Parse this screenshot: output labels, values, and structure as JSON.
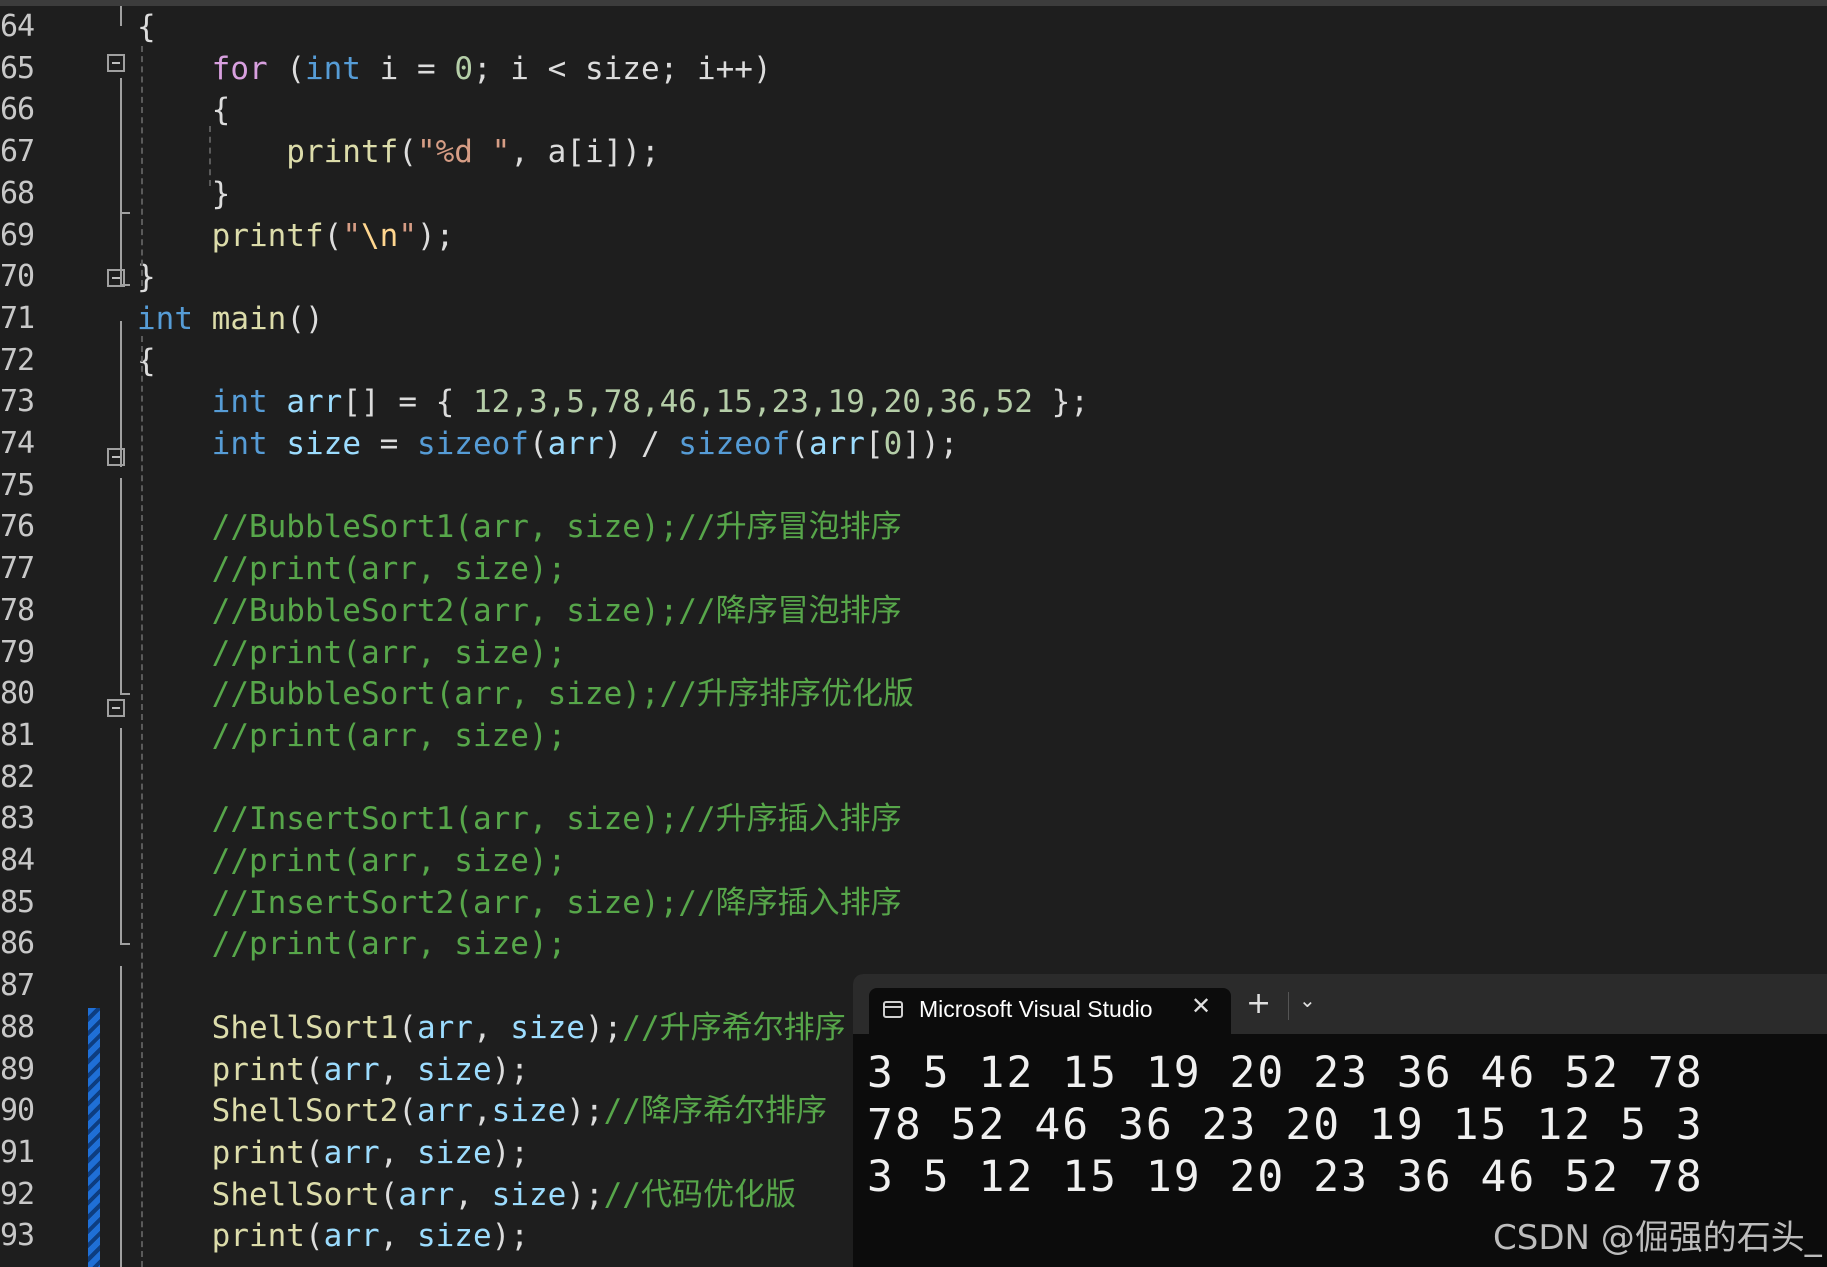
{
  "editor": {
    "lines": [
      {
        "n": "64",
        "segments": [
          {
            "c": "pun",
            "t": "{"
          }
        ]
      },
      {
        "n": "65",
        "segments": [
          {
            "c": "ctl",
            "t": "    for"
          },
          {
            "c": "pun",
            "t": " ("
          },
          {
            "c": "kw",
            "t": "int"
          },
          {
            "c": "pun",
            "t": " i = "
          },
          {
            "c": "num",
            "t": "0"
          },
          {
            "c": "pun",
            "t": "; i < size; i++)"
          }
        ]
      },
      {
        "n": "66",
        "segments": [
          {
            "c": "pun",
            "t": "    {"
          }
        ]
      },
      {
        "n": "67",
        "segments": [
          {
            "c": "fn",
            "t": "        printf"
          },
          {
            "c": "pun",
            "t": "("
          },
          {
            "c": "str",
            "t": "\"%d \""
          },
          {
            "c": "pun",
            "t": ", a[i]);"
          }
        ]
      },
      {
        "n": "68",
        "segments": [
          {
            "c": "pun",
            "t": "    }"
          }
        ]
      },
      {
        "n": "69",
        "segments": [
          {
            "c": "fn",
            "t": "    printf"
          },
          {
            "c": "pun",
            "t": "("
          },
          {
            "c": "str",
            "t": "\""
          },
          {
            "c": "esc",
            "t": "\\n"
          },
          {
            "c": "str",
            "t": "\""
          },
          {
            "c": "pun",
            "t": ");"
          }
        ]
      },
      {
        "n": "70",
        "segments": [
          {
            "c": "pun",
            "t": "}"
          }
        ]
      },
      {
        "n": "71",
        "segments": [
          {
            "c": "kw",
            "t": "int"
          },
          {
            "c": "pun",
            "t": " "
          },
          {
            "c": "fn",
            "t": "main"
          },
          {
            "c": "pun",
            "t": "()"
          }
        ]
      },
      {
        "n": "72",
        "segments": [
          {
            "c": "pun",
            "t": "{"
          }
        ]
      },
      {
        "n": "73",
        "segments": [
          {
            "c": "kw",
            "t": "    int"
          },
          {
            "c": "pun",
            "t": " "
          },
          {
            "c": "var",
            "t": "arr"
          },
          {
            "c": "pun",
            "t": "[] = { "
          },
          {
            "c": "num",
            "t": "12,3,5,78,46,15,23,19,20,36,52"
          },
          {
            "c": "pun",
            "t": " };"
          }
        ]
      },
      {
        "n": "74",
        "segments": [
          {
            "c": "kw",
            "t": "    int"
          },
          {
            "c": "pun",
            "t": " "
          },
          {
            "c": "var",
            "t": "size"
          },
          {
            "c": "pun",
            "t": " = "
          },
          {
            "c": "kw",
            "t": "sizeof"
          },
          {
            "c": "pun",
            "t": "("
          },
          {
            "c": "var",
            "t": "arr"
          },
          {
            "c": "pun",
            "t": ") / "
          },
          {
            "c": "kw",
            "t": "sizeof"
          },
          {
            "c": "pun",
            "t": "("
          },
          {
            "c": "var",
            "t": "arr"
          },
          {
            "c": "pun",
            "t": "["
          },
          {
            "c": "num",
            "t": "0"
          },
          {
            "c": "pun",
            "t": "]);"
          }
        ]
      },
      {
        "n": "75",
        "segments": []
      },
      {
        "n": "76",
        "segments": [
          {
            "c": "cmt",
            "t": "    //BubbleSort1(arr, size);//升序冒泡排序"
          }
        ]
      },
      {
        "n": "77",
        "segments": [
          {
            "c": "cmt",
            "t": "    //print(arr, size);"
          }
        ]
      },
      {
        "n": "78",
        "segments": [
          {
            "c": "cmt",
            "t": "    //BubbleSort2(arr, size);//降序冒泡排序"
          }
        ]
      },
      {
        "n": "79",
        "segments": [
          {
            "c": "cmt",
            "t": "    //print(arr, size);"
          }
        ]
      },
      {
        "n": "80",
        "segments": [
          {
            "c": "cmt",
            "t": "    //BubbleSort(arr, size);//升序排序优化版"
          }
        ]
      },
      {
        "n": "81",
        "segments": [
          {
            "c": "cmt",
            "t": "    //print(arr, size);"
          }
        ]
      },
      {
        "n": "82",
        "segments": []
      },
      {
        "n": "83",
        "segments": [
          {
            "c": "cmt",
            "t": "    //InsertSort1(arr, size);//升序插入排序"
          }
        ]
      },
      {
        "n": "84",
        "segments": [
          {
            "c": "cmt",
            "t": "    //print(arr, size);"
          }
        ]
      },
      {
        "n": "85",
        "segments": [
          {
            "c": "cmt",
            "t": "    //InsertSort2(arr, size);//降序插入排序"
          }
        ]
      },
      {
        "n": "86",
        "segments": [
          {
            "c": "cmt",
            "t": "    //print(arr, size);"
          }
        ]
      },
      {
        "n": "87",
        "segments": []
      },
      {
        "n": "88",
        "segments": [
          {
            "c": "fn",
            "t": "    ShellSort1"
          },
          {
            "c": "pun",
            "t": "("
          },
          {
            "c": "var",
            "t": "arr"
          },
          {
            "c": "pun",
            "t": ", "
          },
          {
            "c": "var",
            "t": "size"
          },
          {
            "c": "pun",
            "t": ");"
          },
          {
            "c": "cmt",
            "t": "//升序希尔排序"
          }
        ]
      },
      {
        "n": "89",
        "segments": [
          {
            "c": "fn",
            "t": "    print"
          },
          {
            "c": "pun",
            "t": "("
          },
          {
            "c": "var",
            "t": "arr"
          },
          {
            "c": "pun",
            "t": ", "
          },
          {
            "c": "var",
            "t": "size"
          },
          {
            "c": "pun",
            "t": ");"
          }
        ]
      },
      {
        "n": "90",
        "segments": [
          {
            "c": "fn",
            "t": "    ShellSort2"
          },
          {
            "c": "pun",
            "t": "("
          },
          {
            "c": "var",
            "t": "arr"
          },
          {
            "c": "pun",
            "t": ","
          },
          {
            "c": "var",
            "t": "size"
          },
          {
            "c": "pun",
            "t": ");"
          },
          {
            "c": "cmt",
            "t": "//降序希尔排序"
          }
        ]
      },
      {
        "n": "91",
        "segments": [
          {
            "c": "fn",
            "t": "    print"
          },
          {
            "c": "pun",
            "t": "("
          },
          {
            "c": "var",
            "t": "arr"
          },
          {
            "c": "pun",
            "t": ", "
          },
          {
            "c": "var",
            "t": "size"
          },
          {
            "c": "pun",
            "t": ");"
          }
        ]
      },
      {
        "n": "92",
        "segments": [
          {
            "c": "fn",
            "t": "    ShellSort"
          },
          {
            "c": "pun",
            "t": "("
          },
          {
            "c": "var",
            "t": "arr"
          },
          {
            "c": "pun",
            "t": ", "
          },
          {
            "c": "var",
            "t": "size"
          },
          {
            "c": "pun",
            "t": ");"
          },
          {
            "c": "cmt",
            "t": "//代码优化版"
          }
        ]
      },
      {
        "n": "93",
        "segments": [
          {
            "c": "fn",
            "t": "    print"
          },
          {
            "c": "pun",
            "t": "("
          },
          {
            "c": "var",
            "t": "arr"
          },
          {
            "c": "pun",
            "t": ", "
          },
          {
            "c": "var",
            "t": "size"
          },
          {
            "c": "pun",
            "t": ");"
          }
        ]
      }
    ]
  },
  "terminal": {
    "tab_title": "Microsoft Visual Studio",
    "tab_icon": "console-icon",
    "close_glyph": "✕",
    "new_tab_glyph": "+",
    "dropdown_glyph": "⌄",
    "output": [
      "3 5 12 15 19 20 23 36 46 52 78",
      "78 52 46 36 23 20 19 15 12 5 3",
      "3 5 12 15 19 20 23 36 46 52 78"
    ]
  },
  "watermark": "CSDN @倔强的石头_",
  "colors": {
    "background": "#1e1e1e",
    "keyword": "#569cd6",
    "control": "#d8a0df",
    "function": "#dcdcaa",
    "variable": "#9cdcfe",
    "string": "#d69d85",
    "number": "#b5cea8",
    "comment": "#57a64a",
    "change_bar": "#1f6fd6"
  }
}
